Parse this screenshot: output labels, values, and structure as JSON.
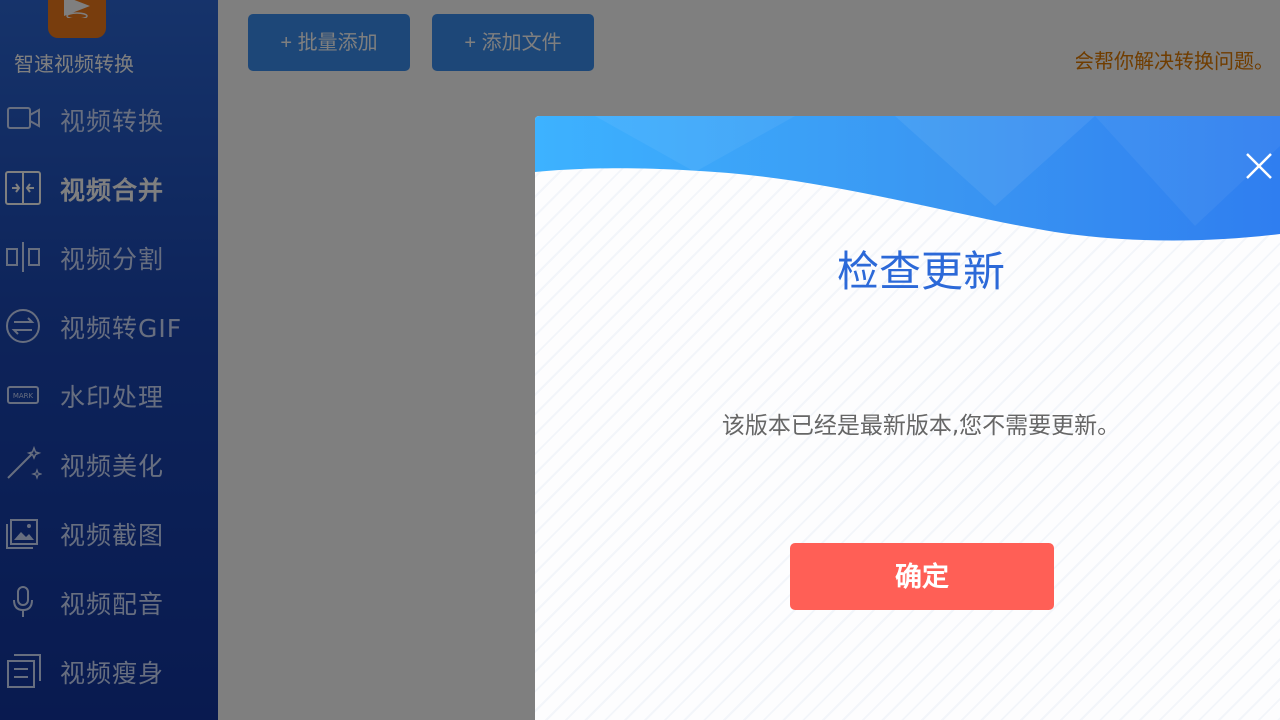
{
  "app": {
    "title": "智速视频转换"
  },
  "sidebar": {
    "items": [
      {
        "label": "视频转换",
        "icon": "video-camera-icon",
        "active": false
      },
      {
        "label": "视频合并",
        "icon": "merge-icon",
        "active": true
      },
      {
        "label": "视频分割",
        "icon": "split-icon",
        "active": false
      },
      {
        "label": "视频转GIF",
        "icon": "convert-arrows-icon",
        "active": false
      },
      {
        "label": "水印处理",
        "icon": "watermark-icon",
        "active": false
      },
      {
        "label": "视频美化",
        "icon": "magic-wand-icon",
        "active": false
      },
      {
        "label": "视频截图",
        "icon": "screenshot-icon",
        "active": false
      },
      {
        "label": "视频配音",
        "icon": "microphone-icon",
        "active": false
      },
      {
        "label": "视频瘦身",
        "icon": "compress-icon",
        "active": false
      }
    ]
  },
  "toolbar": {
    "batch_add_label": "+ 批量添加",
    "add_file_label": "+ 添加文件"
  },
  "notice": {
    "text": "我们会帮你解决转换问题。"
  },
  "dialog": {
    "title": "检查更新",
    "message": "该版本已经是最新版本,您不需要更新。",
    "confirm_label": "确定"
  },
  "colors": {
    "sidebar": "#1b47b4",
    "accent": "#3a8ef0",
    "confirm": "#ff5f56",
    "title": "#2c69d8",
    "notice": "#e07a00"
  }
}
